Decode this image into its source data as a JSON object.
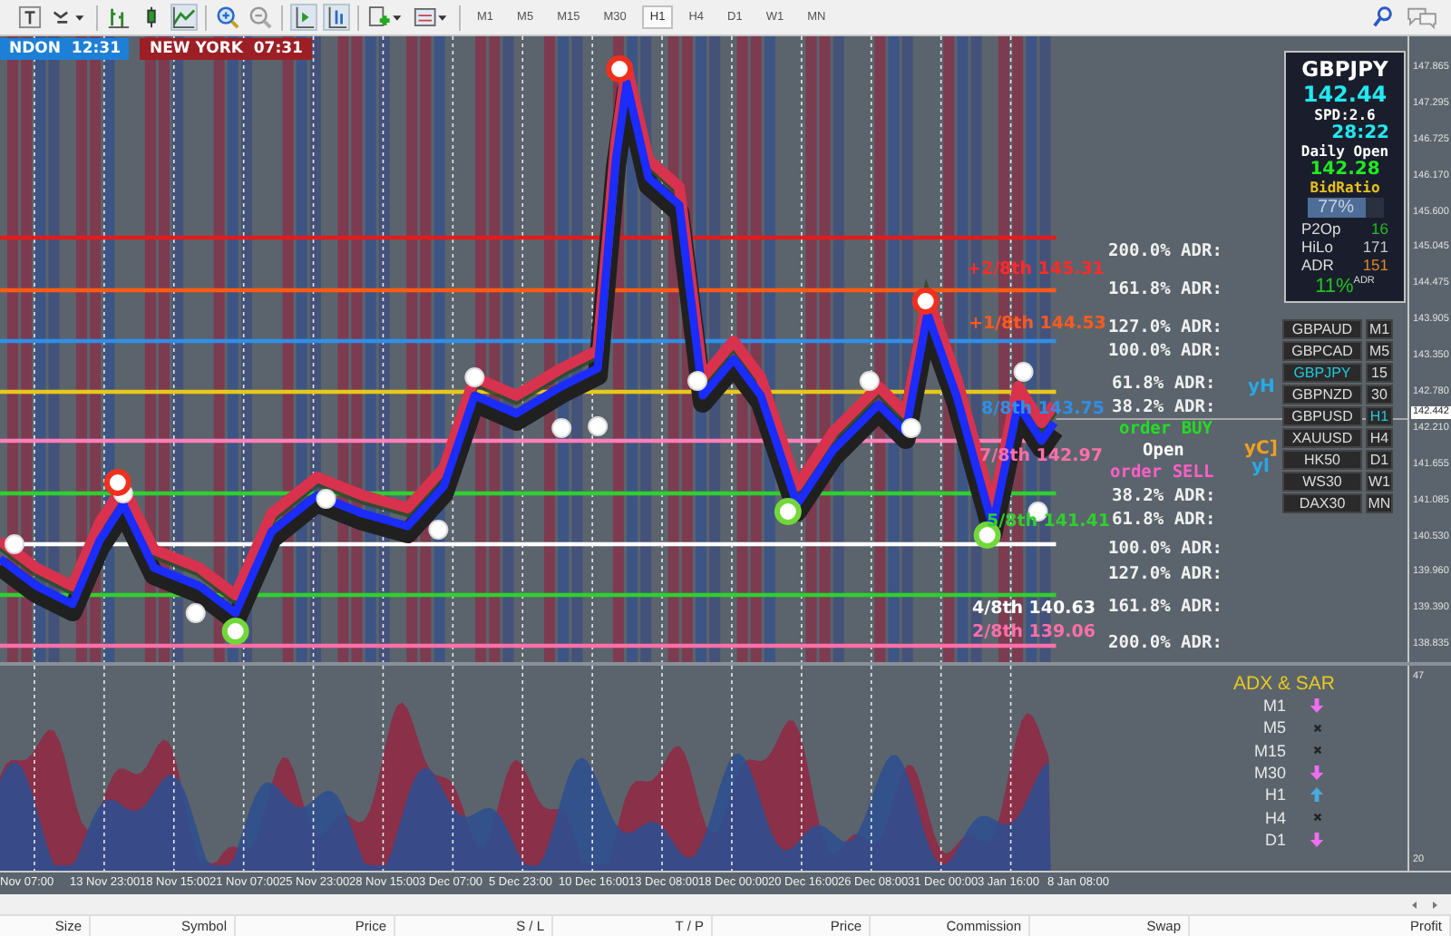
{
  "toolbar": {
    "timeframes": [
      {
        "label": "M1",
        "selected": false
      },
      {
        "label": "M5",
        "selected": false
      },
      {
        "label": "M15",
        "selected": false
      },
      {
        "label": "M30",
        "selected": false
      },
      {
        "label": "H1",
        "selected": true
      },
      {
        "label": "H4",
        "selected": false
      },
      {
        "label": "D1",
        "selected": false
      },
      {
        "label": "W1",
        "selected": false
      },
      {
        "label": "MN",
        "selected": false
      }
    ]
  },
  "sessions": [
    {
      "city": "NDON",
      "time": "12:31",
      "color": "#1e7fd6"
    },
    {
      "city": "NEW YORK",
      "time": "07:31",
      "color": "#9c1f25"
    }
  ],
  "murrey_levels": [
    {
      "label": "+2/8th 145.31",
      "color": "#ff2a2a"
    },
    {
      "label": "+1/8th 144.53",
      "color": "#ff5a1e"
    },
    {
      "label": "8/8th 143.75",
      "color": "#2f8fe8"
    },
    {
      "label": "7/8th 142.97",
      "color": "#ff6fa8"
    },
    {
      "label": "5/8th 141.41",
      "color": "#2fcf2f"
    },
    {
      "label": "4/8th 140.63",
      "color": "#ffffff"
    },
    {
      "label": "2/8th 139.06",
      "color": "#ff6fa8"
    }
  ],
  "adr_levels": [
    "200.0% ADR:",
    "161.8% ADR:",
    "127.0% ADR:",
    "100.0% ADR:",
    "61.8% ADR:",
    "38.2% ADR:",
    "38.2% ADR:",
    "61.8% ADR:",
    "100.0% ADR:",
    "127.0% ADR:",
    "161.8% ADR:",
    "200.0% ADR:"
  ],
  "orders": [
    {
      "label": "order BUY",
      "color": "#22dd22"
    },
    {
      "label": "Open",
      "color": "#ffffff"
    },
    {
      "label": "order SELL",
      "color": "#ff5fc8"
    }
  ],
  "side_marks": [
    {
      "label": "yH",
      "color": "#27a9e8"
    },
    {
      "label": "yC]",
      "color": "#f0a020"
    },
    {
      "label": "yl",
      "color": "#27a9e8"
    }
  ],
  "info_panel": {
    "symbol": "GBPJPY",
    "price": "142.44",
    "spread": "SPD:2.6",
    "countdown": "28:22",
    "daily_open_label": "Daily Open",
    "daily_open": "142.28",
    "bid_ratio_label": "BidRatio",
    "bid_ratio": "77%",
    "level": 0.77,
    "stats": [
      {
        "name": "P2Op",
        "value": "16",
        "color": "#22c022"
      },
      {
        "name": "HiLo",
        "value": "171",
        "color": "#c8c8c8"
      },
      {
        "name": "ADR",
        "value": "151",
        "color": "#e0882a"
      }
    ],
    "adr_percent": "11%",
    "adr_suffix": "ADR"
  },
  "symbols": [
    {
      "symbol": "GBPAUD",
      "timeframe": "M1",
      "selected": false,
      "timeframe_selected": false
    },
    {
      "symbol": "GBPCAD",
      "timeframe": "M5",
      "selected": false,
      "timeframe_selected": false
    },
    {
      "symbol": "GBPJPY",
      "timeframe": "15",
      "selected": true,
      "timeframe_selected": false
    },
    {
      "symbol": "GBPNZD",
      "timeframe": "30",
      "selected": false,
      "timeframe_selected": false
    },
    {
      "symbol": "GBPUSD",
      "timeframe": "H1",
      "selected": false,
      "timeframe_selected": true
    },
    {
      "symbol": "XAUUSD",
      "timeframe": "H4",
      "selected": false,
      "timeframe_selected": false
    },
    {
      "symbol": "HK50",
      "timeframe": "D1",
      "selected": false,
      "timeframe_selected": false
    },
    {
      "symbol": "WS30",
      "timeframe": "W1",
      "selected": false,
      "timeframe_selected": false
    },
    {
      "symbol": "DAX30",
      "timeframe": "MN",
      "selected": false,
      "timeframe_selected": false
    }
  ],
  "price_axis": {
    "labels": [
      "147.865",
      "147.295",
      "146.725",
      "146.170",
      "145.600",
      "145.045",
      "144.475",
      "143.905",
      "143.350",
      "142.780",
      "142.210",
      "141.655",
      "141.085",
      "140.530",
      "139.960",
      "139.390",
      "138.835"
    ],
    "current": "142.442"
  },
  "adx_sar": {
    "title": "ADX & SAR",
    "rows": [
      {
        "timeframe": "M1",
        "kind": "down"
      },
      {
        "timeframe": "M5",
        "kind": "none"
      },
      {
        "timeframe": "M15",
        "kind": "none"
      },
      {
        "timeframe": "M30",
        "kind": "down"
      },
      {
        "timeframe": "H1",
        "kind": "up"
      },
      {
        "timeframe": "H4",
        "kind": "none"
      },
      {
        "timeframe": "D1",
        "kind": "down"
      }
    ]
  },
  "indicator_axis": [
    "47",
    "20"
  ],
  "time_axis": [
    "Nov 07:00",
    "13 Nov 23:00",
    "18 Nov 15:00",
    "21 Nov 07:00",
    "25 Nov 23:00",
    "28 Nov 15:00",
    "3 Dec 07:00",
    "5 Dec 23:00",
    "10 Dec 16:00",
    "13 Dec 08:00",
    "18 Dec 00:00",
    "20 Dec 16:00",
    "26 Dec 08:00",
    "31 Dec 00:00",
    "3 Jan 16:00",
    "8 Jan 08:00"
  ],
  "orders_table": {
    "columns": [
      "Size",
      "Symbol",
      "Price",
      "S / L",
      "T / P",
      "Price",
      "Commission",
      "Swap",
      "Profit"
    ]
  }
}
